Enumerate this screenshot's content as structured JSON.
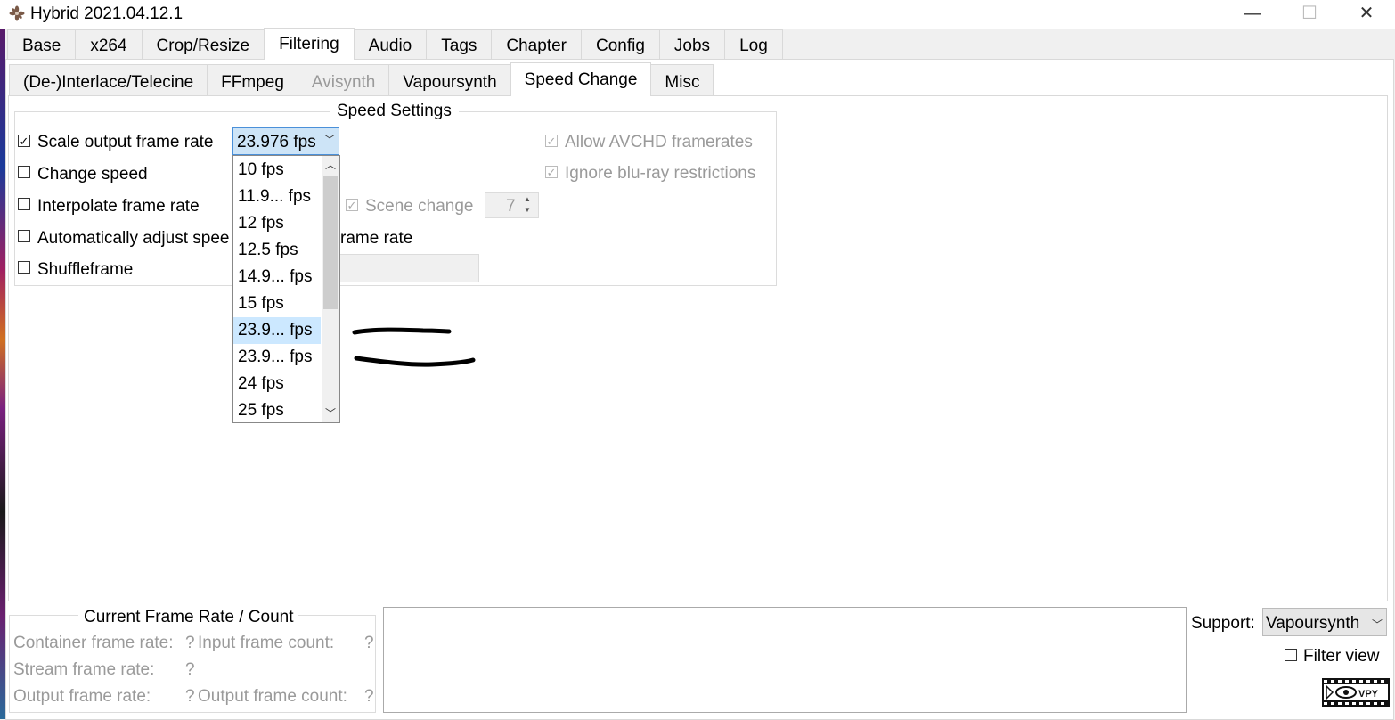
{
  "window": {
    "title": "Hybrid 2021.04.12.1",
    "minimize_glyph": "—",
    "maximize_glyph": "☐",
    "close_glyph": "✕"
  },
  "main_tabs": [
    {
      "label": "Base",
      "active": false
    },
    {
      "label": "x264",
      "active": false
    },
    {
      "label": "Crop/Resize",
      "active": false
    },
    {
      "label": "Filtering",
      "active": true
    },
    {
      "label": "Audio",
      "active": false
    },
    {
      "label": "Tags",
      "active": false
    },
    {
      "label": "Chapter",
      "active": false
    },
    {
      "label": "Config",
      "active": false
    },
    {
      "label": "Jobs",
      "active": false
    },
    {
      "label": "Log",
      "active": false
    }
  ],
  "sub_tabs": [
    {
      "label": "(De-)Interlace/Telecine",
      "active": false,
      "disabled": false
    },
    {
      "label": "FFmpeg",
      "active": false,
      "disabled": false
    },
    {
      "label": "Avisynth",
      "active": false,
      "disabled": true
    },
    {
      "label": "Vapoursynth",
      "active": false,
      "disabled": false
    },
    {
      "label": "Speed Change",
      "active": true,
      "disabled": false
    },
    {
      "label": "Misc",
      "active": false,
      "disabled": false
    }
  ],
  "speed_settings": {
    "title": "Speed Settings",
    "scale_output_frame_rate": {
      "label": "Scale output frame rate",
      "checked": true
    },
    "change_speed": {
      "label": "Change speed",
      "checked": false
    },
    "interpolate_frame_rate": {
      "label": "Interpolate frame rate",
      "checked": false
    },
    "auto_adjust": {
      "label_left": "Automatically adjust spee",
      "label_right": "rame rate",
      "checked": false
    },
    "shuffleframe": {
      "label": "Shuffleframe",
      "checked": false
    },
    "allow_avchd": {
      "label": "Allow AVCHD framerates",
      "checked": true,
      "disabled": true
    },
    "ignore_bluray": {
      "label": "Ignore blu-ray restrictions",
      "checked": true,
      "disabled": true
    },
    "scene_change": {
      "label": "Scene change",
      "checked": true,
      "disabled": true,
      "value": "7"
    },
    "frame_rate_combo": {
      "value": "23.976 fps",
      "options": [
        "10 fps",
        "11.9... fps",
        "12 fps",
        "12.5 fps",
        "14.9... fps",
        "15 fps",
        "23.9... fps",
        "23.9... fps",
        "24 fps",
        "25 fps"
      ],
      "highlighted_index": 6
    }
  },
  "frame_rate_panel": {
    "title": "Current Frame Rate / Count",
    "container_label": "Container frame rate:",
    "container_value": "?",
    "input_count_label": "Input frame count:",
    "input_count_value": "?",
    "stream_label": "Stream frame rate:",
    "stream_value": "?",
    "output_label": "Output frame rate:",
    "output_value": "?",
    "output_count_label": "Output frame count:",
    "output_count_value": "?"
  },
  "support": {
    "label": "Support:",
    "value": "Vapoursynth",
    "filter_view_label": "Filter view",
    "filter_view_checked": false,
    "vpy_label": "VPY"
  },
  "icons": [
    "app-icon",
    "check-icon",
    "chevron-down-icon",
    "scroll-up-icon",
    "scroll-down-icon",
    "spin-up-icon",
    "spin-down-icon",
    "vpy-preview-icon"
  ]
}
